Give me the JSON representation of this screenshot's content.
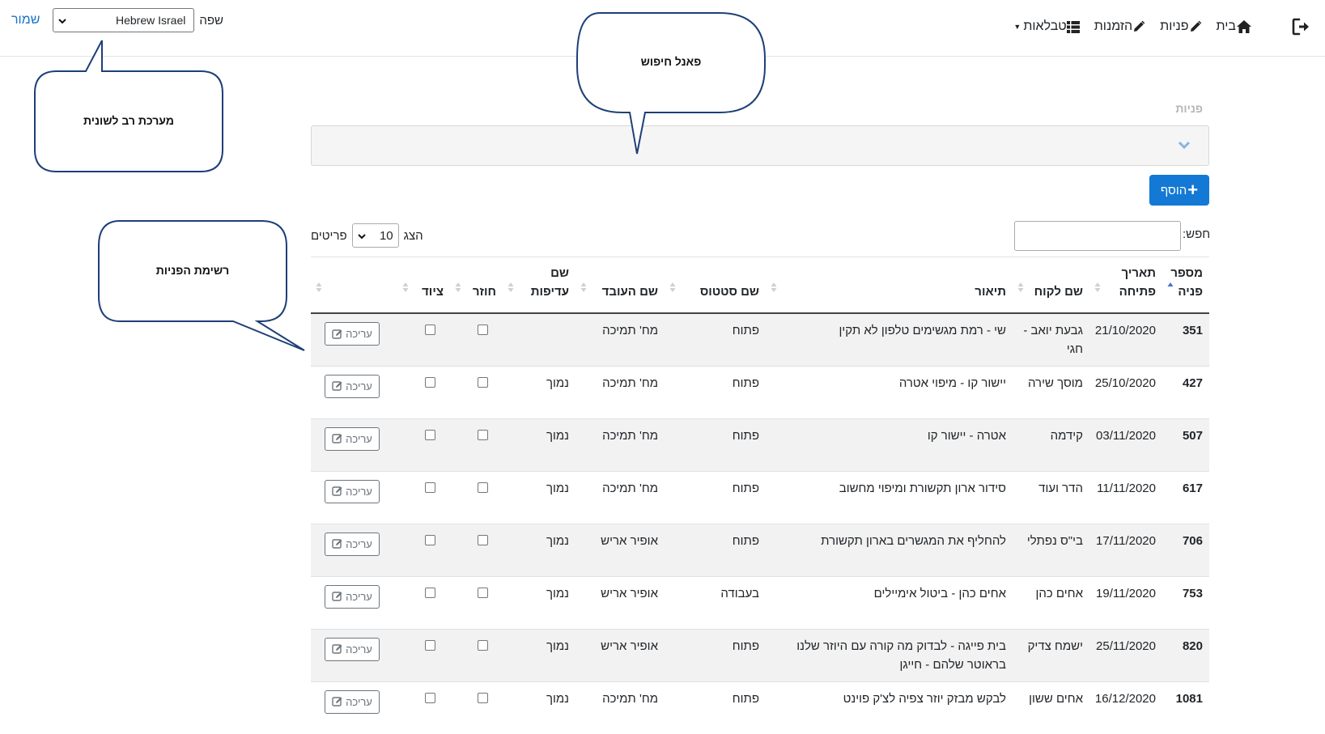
{
  "navbar": {
    "items": [
      {
        "label": "בית",
        "icon": "home-icon"
      },
      {
        "label": "פניות",
        "icon": "pencil-icon"
      },
      {
        "label": "הזמנות",
        "icon": "pencil-icon"
      },
      {
        "label": "טבלאות",
        "icon": "table-list-icon"
      }
    ],
    "logout_icon": "logout-icon",
    "language_label": "שפה",
    "language_value": "Hebrew Israel",
    "save_label": "שמור"
  },
  "callouts": {
    "search_panel": "פאנל חיפוש",
    "multilingual": "מערכת רב לשונית",
    "requests_list": "רשימת הפניות"
  },
  "page": {
    "section_title": "פניות",
    "add_button": "הוסף",
    "search_label": "חפש:",
    "length": {
      "show": "הצג",
      "value": "10",
      "items": "פריטים"
    }
  },
  "table": {
    "headers": [
      "מספר פניה",
      "תאריך פתיחה",
      "שם לקוח",
      "תיאור",
      "שם סטטוס",
      "שם העובד",
      "שם עדיפות",
      "חוזר",
      "ציוד",
      ""
    ],
    "edit_label": "עריכה",
    "rows": [
      {
        "id": "351",
        "date": "21/10/2020",
        "customer": "גבעת יואב - חגי",
        "description": "שי - רמת מגשימים טלפון לא תקין",
        "status": "פתוח",
        "employee": "מח' תמיכה",
        "priority": ""
      },
      {
        "id": "427",
        "date": "25/10/2020",
        "customer": "מוסך שירה",
        "description": "יישור קו - מיפוי אטרה",
        "status": "פתוח",
        "employee": "מח' תמיכה",
        "priority": "נמוך"
      },
      {
        "id": "507",
        "date": "03/11/2020",
        "customer": "קידמה",
        "description": "אטרה - יישור קו",
        "status": "פתוח",
        "employee": "מח' תמיכה",
        "priority": "נמוך"
      },
      {
        "id": "617",
        "date": "11/11/2020",
        "customer": "הדר ועוד",
        "description": "סידור ארון תקשורת ומיפוי מחשוב",
        "status": "פתוח",
        "employee": "מח' תמיכה",
        "priority": "נמוך"
      },
      {
        "id": "706",
        "date": "17/11/2020",
        "customer": "בי\"ס נפתלי",
        "description": "להחליף את המגשרים בארון תקשורת",
        "status": "פתוח",
        "employee": "אופיר אריש",
        "priority": "נמוך"
      },
      {
        "id": "753",
        "date": "19/11/2020",
        "customer": "אחים כהן",
        "description": "אחים כהן - ביטול אימיילים",
        "status": "בעבודה",
        "employee": "אופיר אריש",
        "priority": "נמוך"
      },
      {
        "id": "820",
        "date": "25/11/2020",
        "customer": "ישמח צדיק",
        "description": "בית פייגה - לבדוק מה קורה עם היוזר שלנו בראוטר שלהם - חייגן",
        "status": "פתוח",
        "employee": "אופיר אריש",
        "priority": "נמוך"
      },
      {
        "id": "1081",
        "date": "16/12/2020",
        "customer": "אחים ששון",
        "description": "לבקש מבזק יוזר צפיה לצ'ק פוינט",
        "status": "פתוח",
        "employee": "מח' תמיכה",
        "priority": "נמוך"
      }
    ]
  }
}
